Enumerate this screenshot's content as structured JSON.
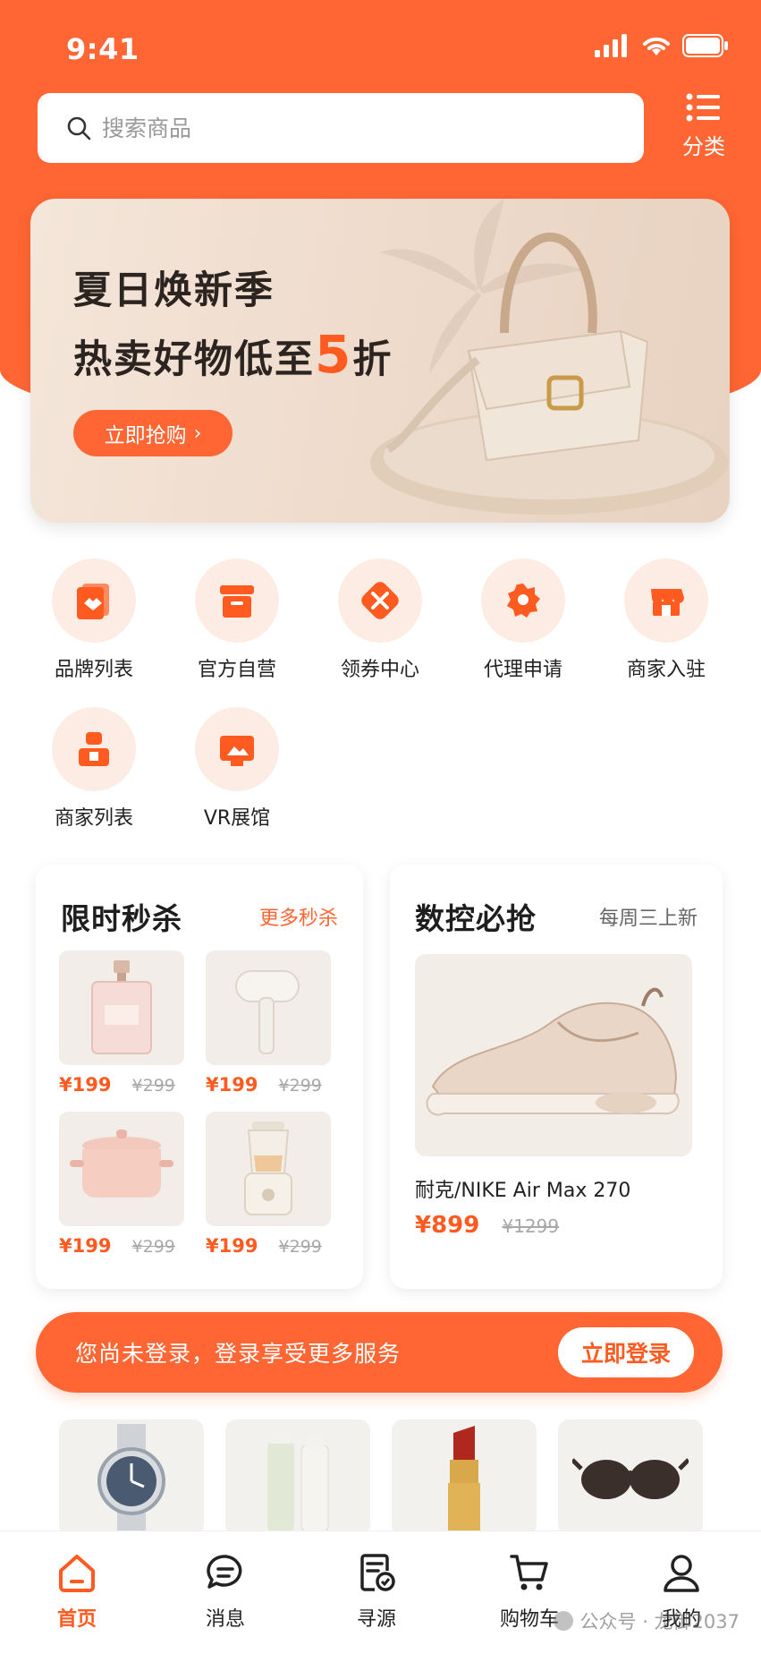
{
  "status_bar": {
    "time": "9:41"
  },
  "search": {
    "placeholder": "搜索商品"
  },
  "category": {
    "label": "分类"
  },
  "banner": {
    "title_line1": "夏日焕新季",
    "title_line2_prefix": "热卖好物低至",
    "title_line2_highlight": "5",
    "title_line2_suffix": "折",
    "button_label": "立即抢购"
  },
  "quick_nav": [
    {
      "label": "品牌列表",
      "icon": "brand-list-icon"
    },
    {
      "label": "官方自营",
      "icon": "official-store-icon"
    },
    {
      "label": "领券中心",
      "icon": "coupon-center-icon"
    },
    {
      "label": "代理申请",
      "icon": "agent-apply-icon"
    },
    {
      "label": "商家入驻",
      "icon": "merchant-join-icon"
    },
    {
      "label": "商家列表",
      "icon": "merchant-list-icon"
    },
    {
      "label": "VR展馆",
      "icon": "vr-hall-icon"
    }
  ],
  "flash_sale": {
    "title": "限时秒杀",
    "more_label": "更多秒杀",
    "items": [
      {
        "image": "perfume-image",
        "price": "¥199",
        "old_price": "¥299"
      },
      {
        "image": "hair-dryer-image",
        "price": "¥199",
        "old_price": "¥299"
      },
      {
        "image": "ceramic-pot-image",
        "price": "¥199",
        "old_price": "¥299"
      },
      {
        "image": "blender-image",
        "price": "¥199",
        "old_price": "¥299"
      }
    ]
  },
  "featured": {
    "title": "数控必抢",
    "subtitle": "每周三上新",
    "product_name": "耐克/NIKE Air Max 270",
    "price": "¥899",
    "old_price": "¥1299",
    "image": "sneaker-image"
  },
  "login_prompt": {
    "text": "您尚未登录，登录享受更多服务",
    "button_label": "立即登录"
  },
  "product_strip": [
    {
      "image": "watch-image"
    },
    {
      "image": "skincare-image"
    },
    {
      "image": "lipstick-image"
    },
    {
      "image": "sunglasses-image"
    }
  ],
  "tab_bar": [
    {
      "label": "首页",
      "icon": "home-icon",
      "active": true
    },
    {
      "label": "消息",
      "icon": "message-icon",
      "active": false
    },
    {
      "label": "寻源",
      "icon": "sourcing-icon",
      "active": false
    },
    {
      "label": "购物车",
      "icon": "cart-icon",
      "active": false
    },
    {
      "label": "我的",
      "icon": "profile-icon",
      "active": false
    }
  ],
  "watermark": {
    "text": "公众号 · 龙御2037"
  },
  "colors": {
    "accent": "#ff6633",
    "price": "#ff5a1f",
    "banner_bg": "#f4e6da"
  }
}
